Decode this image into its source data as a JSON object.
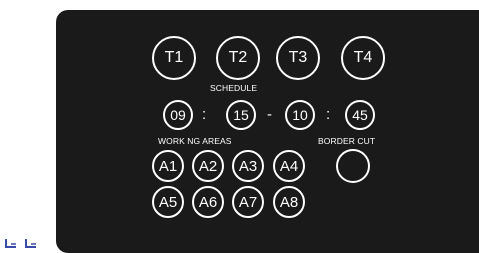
{
  "tools": [
    {
      "label": "T1"
    },
    {
      "label": "T2"
    },
    {
      "label": "T3"
    },
    {
      "label": "T4"
    }
  ],
  "schedule": {
    "label": "SCHEDULE",
    "start_hour": "09",
    "start_minute": "15",
    "end_hour": "10",
    "end_minute": "45",
    "colon": ":",
    "dash": "-"
  },
  "working_areas": {
    "label": "WORK NG AREAS",
    "areas": [
      {
        "label": "A1"
      },
      {
        "label": "A2"
      },
      {
        "label": "A3"
      },
      {
        "label": "A4"
      },
      {
        "label": "A5"
      },
      {
        "label": "A6"
      },
      {
        "label": "A7"
      },
      {
        "label": "A8"
      }
    ]
  },
  "border_cut": {
    "label": "BORDER CUT"
  },
  "colors": {
    "panel": "#1a1a1a",
    "foreground": "#ffffff",
    "corner_icon": "#3a4aa8"
  },
  "icons": {
    "corner_left": "corner-bracket-icon",
    "corner_right": "corner-bracket-icon"
  }
}
